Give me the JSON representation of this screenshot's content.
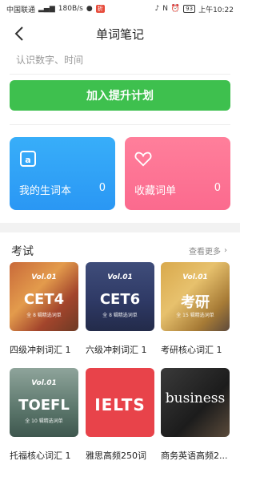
{
  "status_bar": {
    "carrier": "中国联通",
    "speed": "180B/s",
    "badge": "折",
    "battery": "93",
    "time": "上午10:22"
  },
  "header": {
    "title": "单词笔记"
  },
  "search": {
    "placeholder": "认识数字、时间"
  },
  "primary_button": {
    "label": "加入提升计划",
    "color": "#3ec04e"
  },
  "cards": [
    {
      "label": "我的生词本",
      "count": "0",
      "icon": "vocab-book-icon",
      "color": "#2a97f4"
    },
    {
      "label": "收藏词单",
      "count": "0",
      "icon": "heart-icon",
      "color": "#fb6a8e"
    }
  ],
  "section": {
    "title": "考试",
    "more": "查看更多"
  },
  "books": [
    {
      "vol": "Vol.01",
      "title": "CET4",
      "subtitle": "全 8 辑精选词单",
      "caption": "四级冲刺词汇 1"
    },
    {
      "vol": "Vol.01",
      "title": "CET6",
      "subtitle": "全 8 辑精选词单",
      "caption": "六级冲刺词汇 1"
    },
    {
      "vol": "Vol.01",
      "title": "考研",
      "subtitle": "全 15 辑精选词单",
      "caption": "考研核心词汇 1"
    },
    {
      "vol": "Vol.01",
      "title": "TOEFL",
      "subtitle": "全 10 辑精选词单",
      "caption": "托福核心词汇 1"
    },
    {
      "vol": "",
      "title": "IELTS",
      "subtitle": "",
      "caption": "雅思高频250词"
    },
    {
      "vol": "",
      "title": "business",
      "subtitle": "",
      "caption": "商务英语高频2..."
    }
  ]
}
